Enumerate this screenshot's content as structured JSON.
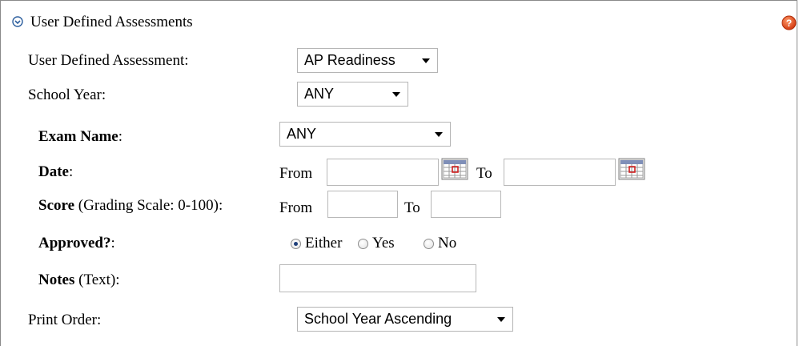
{
  "header": {
    "title": "User Defined Assessments",
    "collapse_icon": "chevron-circle-icon",
    "help_icon": "help-icon"
  },
  "fields": {
    "uda": {
      "label": "User Defined Assessment:",
      "value": "AP Readiness"
    },
    "school_year": {
      "label": "School Year:",
      "value": "ANY"
    },
    "exam_name": {
      "label_bold": "Exam Name",
      "label_rest": ":",
      "value": "ANY"
    },
    "date": {
      "label_bold": "Date",
      "label_rest": ":",
      "from_label": "From",
      "to_label": "To",
      "from_value": "",
      "to_value": ""
    },
    "score": {
      "label_bold": "Score",
      "label_rest": " (Grading Scale: 0-100):",
      "from_label": "From",
      "to_label": "To",
      "from_value": "",
      "to_value": ""
    },
    "approved": {
      "label_bold": "Approved?",
      "label_rest": ":",
      "options": [
        "Either",
        "Yes",
        "No"
      ],
      "selected": "Either"
    },
    "notes": {
      "label_bold": "Notes",
      "label_rest": " (Text):",
      "value": ""
    },
    "print_order": {
      "label": "Print Order:",
      "value": "School Year Ascending"
    }
  },
  "colors": {
    "border": "#8a8a8a",
    "icon_blue": "#2d5f9e",
    "help_orange": "#e24a1c"
  }
}
